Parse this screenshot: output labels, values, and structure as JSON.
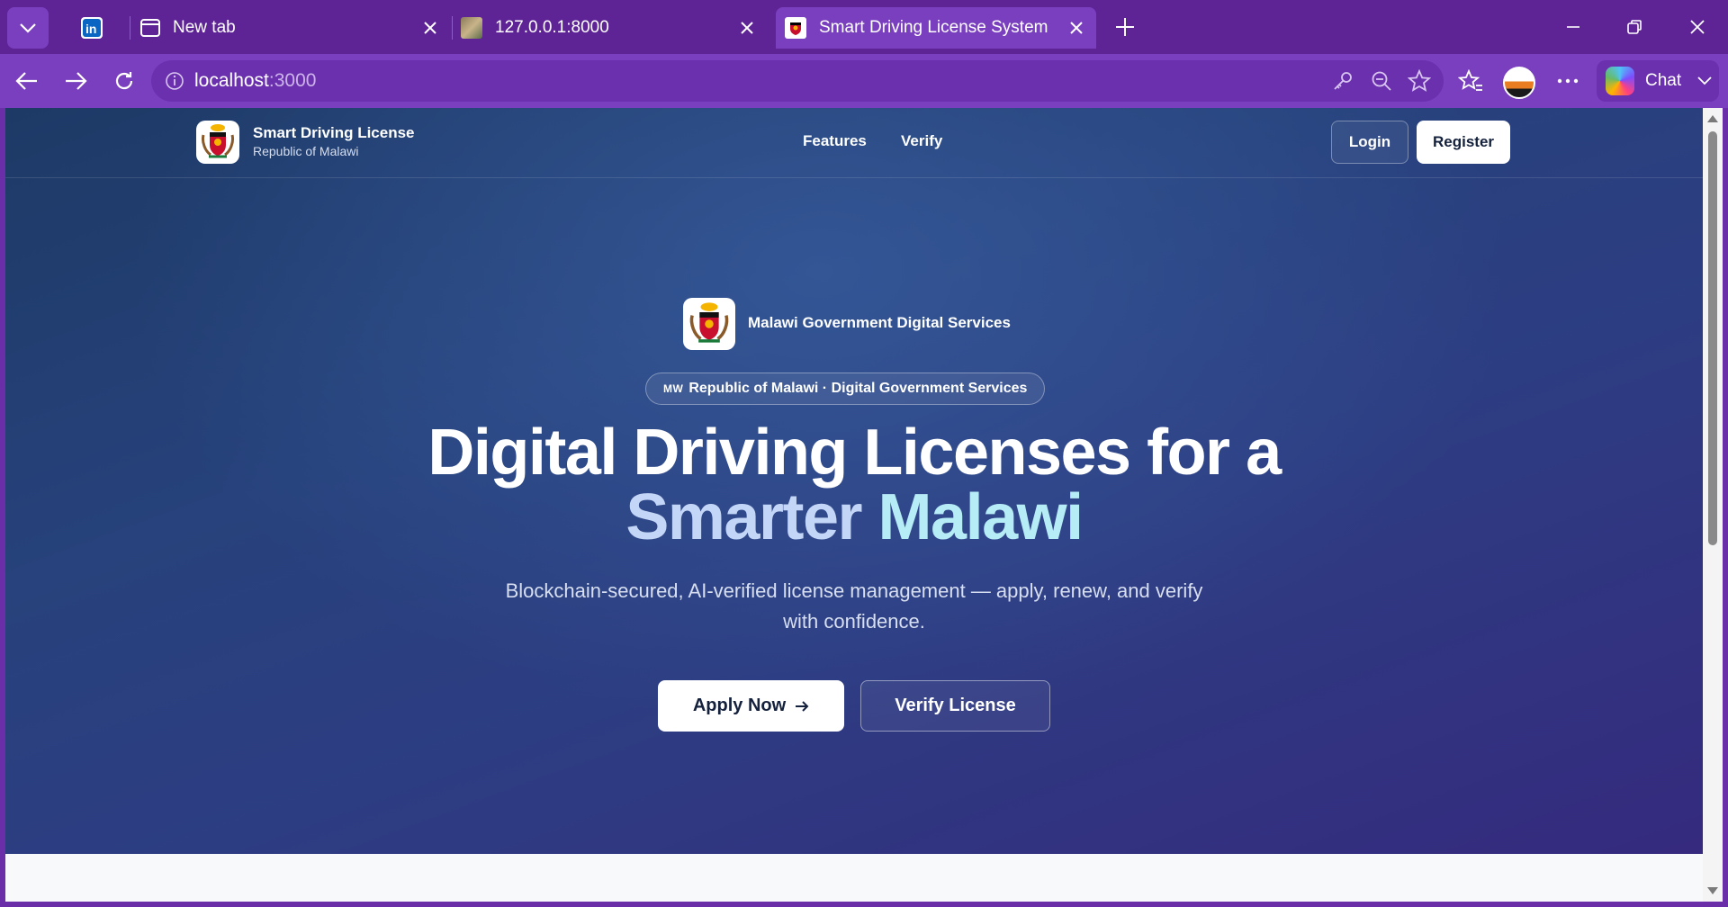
{
  "browser": {
    "tabs": [
      {
        "title": "",
        "icon": "linkedin-icon"
      },
      {
        "title": "New tab",
        "icon": "new-tab-icon"
      },
      {
        "title": "127.0.0.1:8000",
        "icon": "site-favicon"
      },
      {
        "title": "Smart Driving License System",
        "icon": "malawi-coat-of-arms-icon",
        "active": true
      }
    ],
    "address": {
      "host": "localhost",
      "port": ":3000"
    },
    "chat_label": "Chat",
    "accent": "#7a3fbf"
  },
  "site": {
    "brand": {
      "title": "Smart Driving License",
      "subtitle": "Republic of Malawi"
    },
    "nav": {
      "features": "Features",
      "verify": "Verify"
    },
    "auth": {
      "login": "Login",
      "register": "Register"
    },
    "hero": {
      "gov_label": "Malawi Government Digital Services",
      "pill_prefix": "MW",
      "pill_text": "Republic of Malawi · Digital Government Services",
      "headline_line1": "Digital Driving Licenses for a",
      "headline_word1": "Smarter",
      "headline_word2": "Malawi",
      "lead": "Blockchain-secured, AI-verified license management — apply, renew, and verify with confidence.",
      "apply_label": "Apply Now",
      "verify_label": "Verify License"
    }
  }
}
